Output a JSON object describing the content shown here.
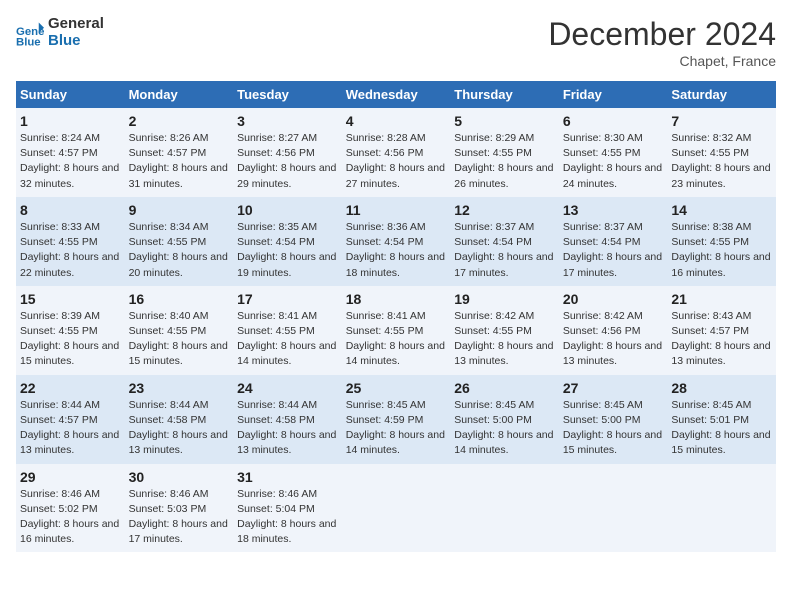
{
  "header": {
    "logo_line1": "General",
    "logo_line2": "Blue",
    "month_title": "December 2024",
    "location": "Chapet, France"
  },
  "days_of_week": [
    "Sunday",
    "Monday",
    "Tuesday",
    "Wednesday",
    "Thursday",
    "Friday",
    "Saturday"
  ],
  "weeks": [
    [
      {
        "day": 1,
        "sunrise": "8:24 AM",
        "sunset": "4:57 PM",
        "daylight": "8 hours and 32 minutes"
      },
      {
        "day": 2,
        "sunrise": "8:26 AM",
        "sunset": "4:57 PM",
        "daylight": "8 hours and 31 minutes"
      },
      {
        "day": 3,
        "sunrise": "8:27 AM",
        "sunset": "4:56 PM",
        "daylight": "8 hours and 29 minutes"
      },
      {
        "day": 4,
        "sunrise": "8:28 AM",
        "sunset": "4:56 PM",
        "daylight": "8 hours and 27 minutes"
      },
      {
        "day": 5,
        "sunrise": "8:29 AM",
        "sunset": "4:55 PM",
        "daylight": "8 hours and 26 minutes"
      },
      {
        "day": 6,
        "sunrise": "8:30 AM",
        "sunset": "4:55 PM",
        "daylight": "8 hours and 24 minutes"
      },
      {
        "day": 7,
        "sunrise": "8:32 AM",
        "sunset": "4:55 PM",
        "daylight": "8 hours and 23 minutes"
      }
    ],
    [
      {
        "day": 8,
        "sunrise": "8:33 AM",
        "sunset": "4:55 PM",
        "daylight": "8 hours and 22 minutes"
      },
      {
        "day": 9,
        "sunrise": "8:34 AM",
        "sunset": "4:55 PM",
        "daylight": "8 hours and 20 minutes"
      },
      {
        "day": 10,
        "sunrise": "8:35 AM",
        "sunset": "4:54 PM",
        "daylight": "8 hours and 19 minutes"
      },
      {
        "day": 11,
        "sunrise": "8:36 AM",
        "sunset": "4:54 PM",
        "daylight": "8 hours and 18 minutes"
      },
      {
        "day": 12,
        "sunrise": "8:37 AM",
        "sunset": "4:54 PM",
        "daylight": "8 hours and 17 minutes"
      },
      {
        "day": 13,
        "sunrise": "8:37 AM",
        "sunset": "4:54 PM",
        "daylight": "8 hours and 17 minutes"
      },
      {
        "day": 14,
        "sunrise": "8:38 AM",
        "sunset": "4:55 PM",
        "daylight": "8 hours and 16 minutes"
      }
    ],
    [
      {
        "day": 15,
        "sunrise": "8:39 AM",
        "sunset": "4:55 PM",
        "daylight": "8 hours and 15 minutes"
      },
      {
        "day": 16,
        "sunrise": "8:40 AM",
        "sunset": "4:55 PM",
        "daylight": "8 hours and 15 minutes"
      },
      {
        "day": 17,
        "sunrise": "8:41 AM",
        "sunset": "4:55 PM",
        "daylight": "8 hours and 14 minutes"
      },
      {
        "day": 18,
        "sunrise": "8:41 AM",
        "sunset": "4:55 PM",
        "daylight": "8 hours and 14 minutes"
      },
      {
        "day": 19,
        "sunrise": "8:42 AM",
        "sunset": "4:55 PM",
        "daylight": "8 hours and 13 minutes"
      },
      {
        "day": 20,
        "sunrise": "8:42 AM",
        "sunset": "4:56 PM",
        "daylight": "8 hours and 13 minutes"
      },
      {
        "day": 21,
        "sunrise": "8:43 AM",
        "sunset": "4:57 PM",
        "daylight": "8 hours and 13 minutes"
      }
    ],
    [
      {
        "day": 22,
        "sunrise": "8:44 AM",
        "sunset": "4:57 PM",
        "daylight": "8 hours and 13 minutes"
      },
      {
        "day": 23,
        "sunrise": "8:44 AM",
        "sunset": "4:58 PM",
        "daylight": "8 hours and 13 minutes"
      },
      {
        "day": 24,
        "sunrise": "8:44 AM",
        "sunset": "4:58 PM",
        "daylight": "8 hours and 13 minutes"
      },
      {
        "day": 25,
        "sunrise": "8:45 AM",
        "sunset": "4:59 PM",
        "daylight": "8 hours and 14 minutes"
      },
      {
        "day": 26,
        "sunrise": "8:45 AM",
        "sunset": "5:00 PM",
        "daylight": "8 hours and 14 minutes"
      },
      {
        "day": 27,
        "sunrise": "8:45 AM",
        "sunset": "5:00 PM",
        "daylight": "8 hours and 15 minutes"
      },
      {
        "day": 28,
        "sunrise": "8:45 AM",
        "sunset": "5:01 PM",
        "daylight": "8 hours and 15 minutes"
      }
    ],
    [
      {
        "day": 29,
        "sunrise": "8:46 AM",
        "sunset": "5:02 PM",
        "daylight": "8 hours and 16 minutes"
      },
      {
        "day": 30,
        "sunrise": "8:46 AM",
        "sunset": "5:03 PM",
        "daylight": "8 hours and 17 minutes"
      },
      {
        "day": 31,
        "sunrise": "8:46 AM",
        "sunset": "5:04 PM",
        "daylight": "8 hours and 18 minutes"
      },
      null,
      null,
      null,
      null
    ]
  ]
}
